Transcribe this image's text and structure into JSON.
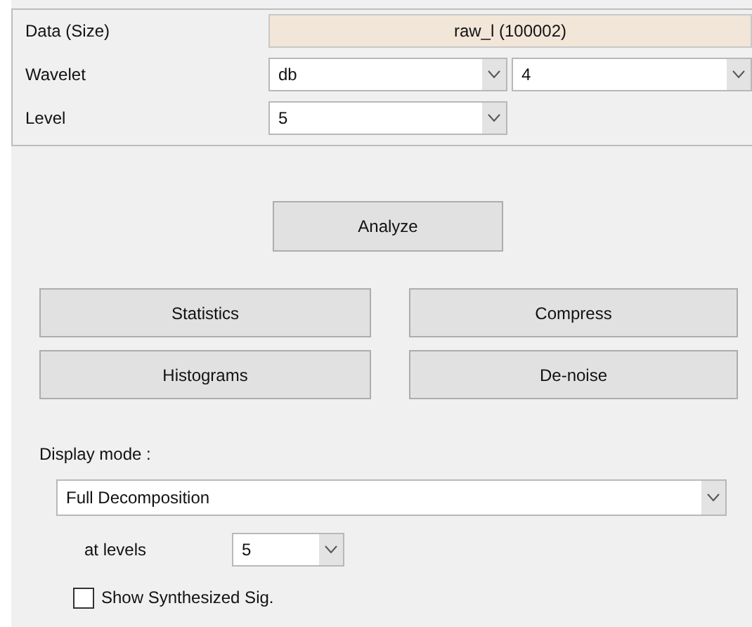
{
  "data_row": {
    "label": "Data  (Size)",
    "value": "raw_l  (100002)"
  },
  "wavelet_row": {
    "label": "Wavelet",
    "family": "db",
    "number": "4"
  },
  "level_row": {
    "label": "Level",
    "value": "5"
  },
  "analyze_button": "Analyze",
  "action_buttons": [
    {
      "label": "Statistics"
    },
    {
      "label": "Compress"
    },
    {
      "label": "Histograms"
    },
    {
      "label": "De-noise"
    }
  ],
  "display_mode": {
    "label": "Display mode :",
    "value": "Full Decomposition"
  },
  "at_levels": {
    "label": "at levels",
    "value": "5"
  },
  "show_synthesized": {
    "label": "Show Synthesized Sig.",
    "checked": false
  }
}
